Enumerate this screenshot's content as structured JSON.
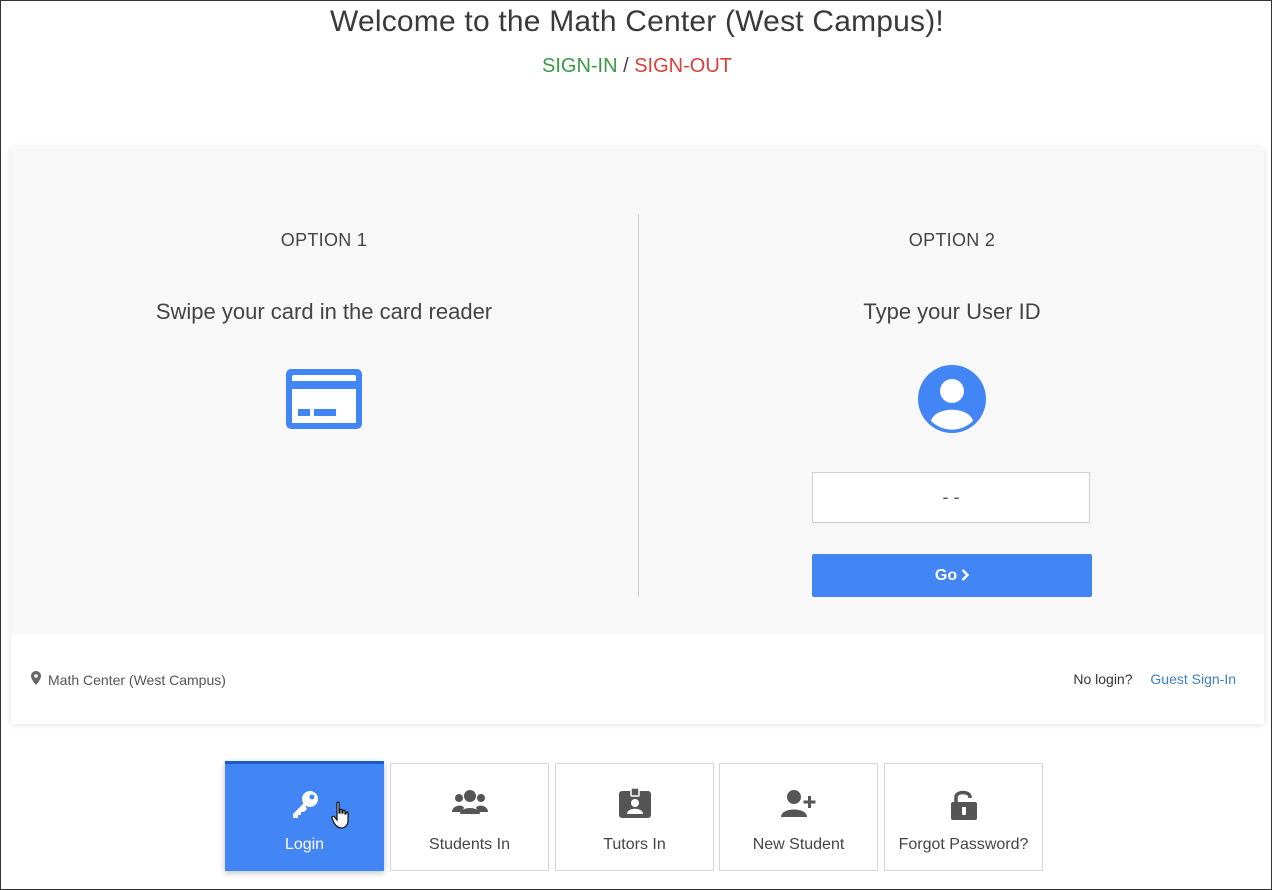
{
  "header": {
    "title": "Welcome to the Math Center (West Campus)!",
    "sign_in": "SIGN-IN",
    "separator": " / ",
    "sign_out": "SIGN-OUT"
  },
  "option1": {
    "label": "OPTION 1",
    "text": "Swipe your card in the card reader",
    "icon": "credit-card-icon"
  },
  "option2": {
    "label": "OPTION 2",
    "text": "Type your User ID",
    "icon": "user-circle-icon",
    "input_value": "- -",
    "go_label": "Go"
  },
  "footer": {
    "location": "Math Center (West Campus)",
    "no_login": "No login?",
    "guest_link": "Guest Sign-In"
  },
  "tabs": [
    {
      "label": "Login",
      "icon": "key-icon",
      "active": true
    },
    {
      "label": "Students In",
      "icon": "users-icon",
      "active": false
    },
    {
      "label": "Tutors In",
      "icon": "id-badge-icon",
      "active": false
    },
    {
      "label": "New Student",
      "icon": "user-plus-icon",
      "active": false
    },
    {
      "label": "Forgot Password?",
      "icon": "unlock-icon",
      "active": false
    }
  ],
  "colors": {
    "accent": "#4285f4",
    "sign_in": "#3a9a45",
    "sign_out": "#d9403a",
    "link": "#3f7fc7"
  }
}
